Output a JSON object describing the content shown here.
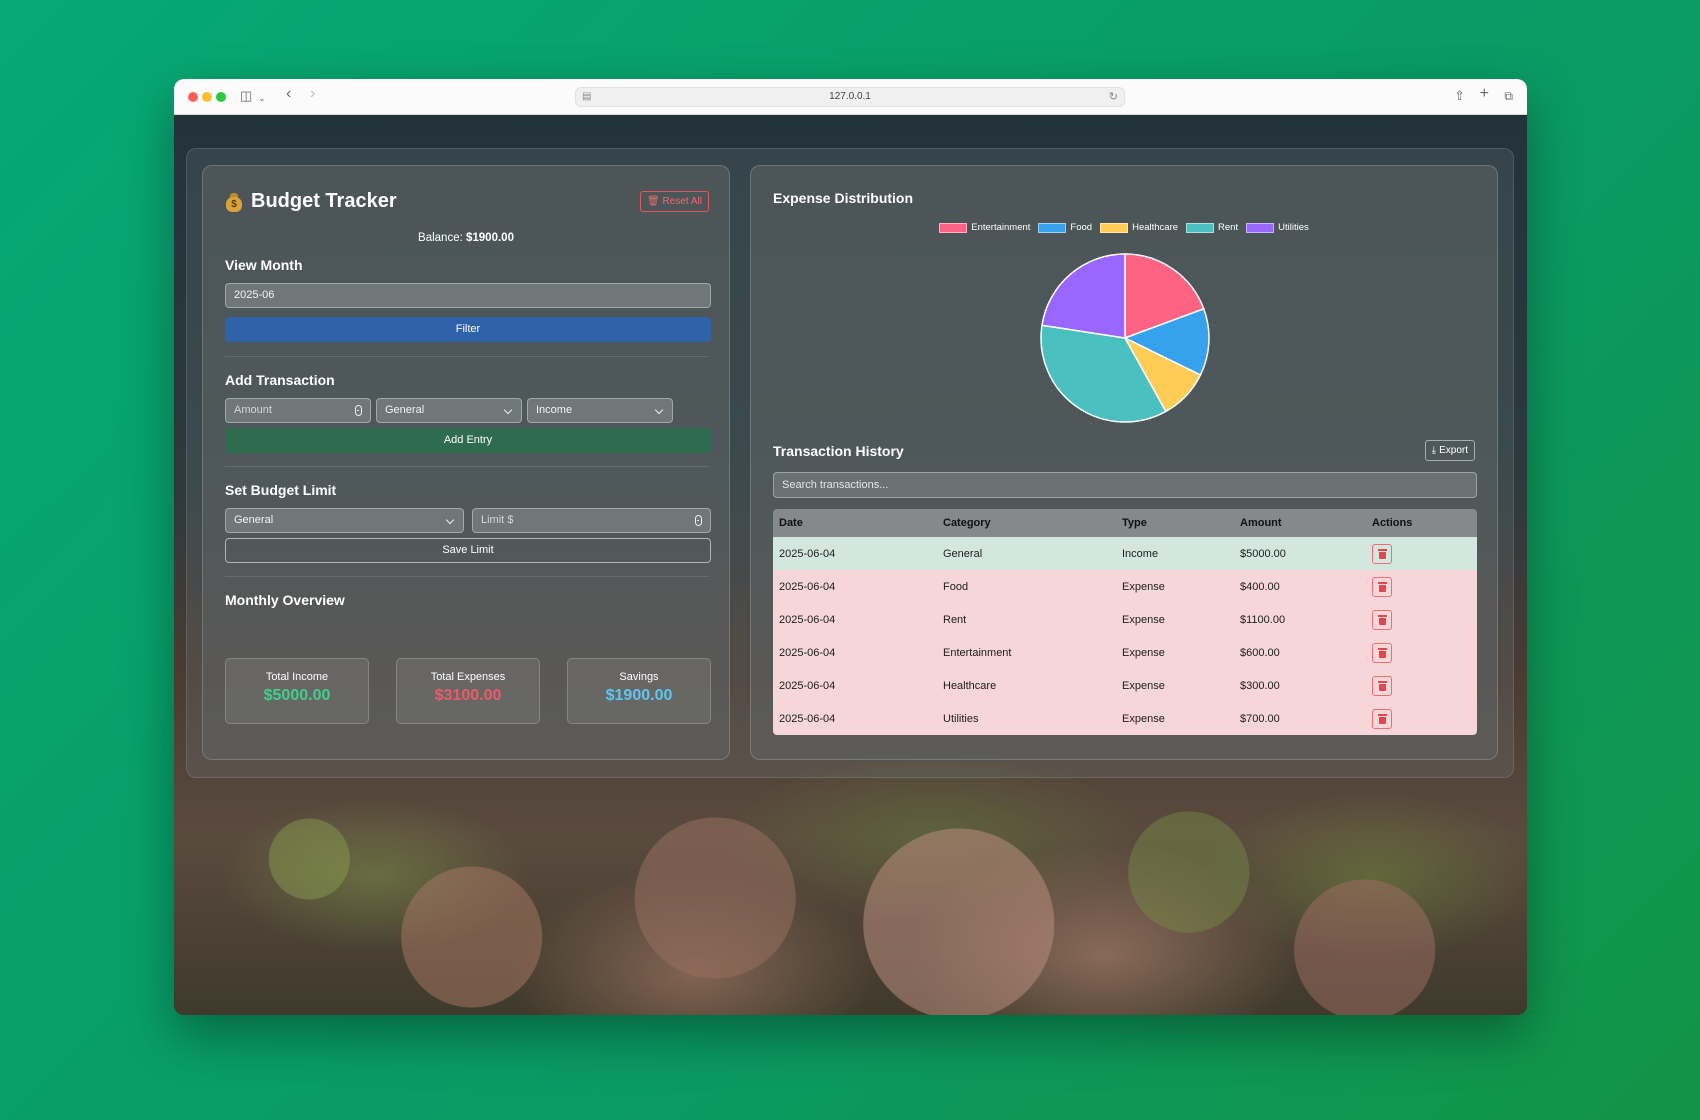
{
  "browser": {
    "url": "127.0.0.1"
  },
  "app": {
    "title": "Budget Tracker",
    "reset_label": "Reset All",
    "balance_label": "Balance:",
    "balance_value": "$1900.00"
  },
  "view_month": {
    "title": "View Month",
    "value": "2025-06",
    "filter_label": "Filter"
  },
  "add_transaction": {
    "title": "Add Transaction",
    "amount_placeholder": "Amount",
    "category_value": "General",
    "type_value": "Income",
    "add_label": "Add Entry"
  },
  "budget_limit": {
    "title": "Set Budget Limit",
    "category_value": "General",
    "limit_placeholder": "Limit $",
    "save_label": "Save Limit"
  },
  "overview": {
    "title": "Monthly Overview",
    "cards": [
      {
        "label": "Total Income",
        "value": "$5000.00",
        "color": "#3fd08a"
      },
      {
        "label": "Total Expenses",
        "value": "$3100.00",
        "color": "#ef5a6a"
      },
      {
        "label": "Savings",
        "value": "$1900.00",
        "color": "#5ec7ef"
      }
    ]
  },
  "chart_data": {
    "type": "pie",
    "title": "Expense Distribution",
    "categories": [
      "Entertainment",
      "Food",
      "Healthcare",
      "Rent",
      "Utilities"
    ],
    "values": [
      600,
      400,
      300,
      1100,
      700
    ],
    "colors": [
      "#ff6384",
      "#36a2eb",
      "#ffcd56",
      "#4bc0c0",
      "#9966ff"
    ],
    "legend_position": "top"
  },
  "history": {
    "title": "Transaction History",
    "export_label": "Export",
    "search_placeholder": "Search transactions...",
    "columns": [
      "Date",
      "Category",
      "Type",
      "Amount",
      "Actions"
    ],
    "rows": [
      {
        "date": "2025-06-04",
        "category": "General",
        "type": "Income",
        "amount": "$5000.00"
      },
      {
        "date": "2025-06-04",
        "category": "Food",
        "type": "Expense",
        "amount": "$400.00"
      },
      {
        "date": "2025-06-04",
        "category": "Rent",
        "type": "Expense",
        "amount": "$1100.00"
      },
      {
        "date": "2025-06-04",
        "category": "Entertainment",
        "type": "Expense",
        "amount": "$600.00"
      },
      {
        "date": "2025-06-04",
        "category": "Healthcare",
        "type": "Expense",
        "amount": "$300.00"
      },
      {
        "date": "2025-06-04",
        "category": "Utilities",
        "type": "Expense",
        "amount": "$700.00"
      }
    ]
  }
}
